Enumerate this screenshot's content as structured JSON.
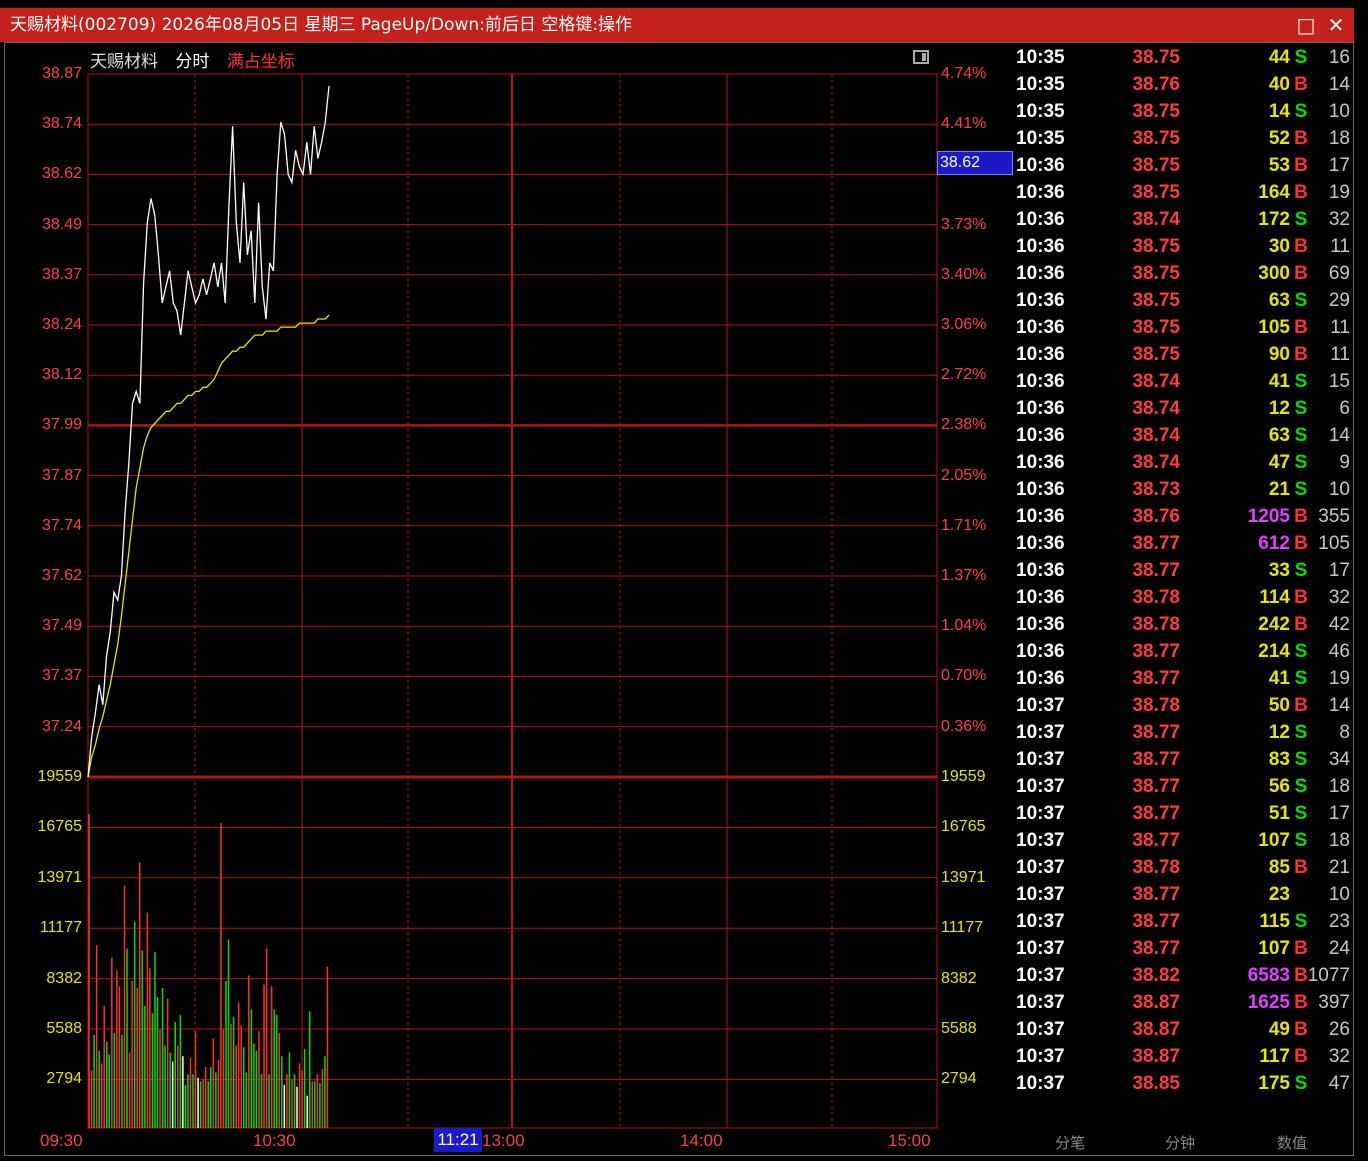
{
  "window": {
    "title": "天赐材料(002709) 2026年08月05日 星期三 PageUp/Down:前后日 空格键:操作",
    "maximize_icon": "□",
    "close_icon": "✕"
  },
  "header": {
    "stock_name": "天赐材料",
    "mode": "分时",
    "scale_mode": "满占坐标"
  },
  "colors": {
    "grid": "#b01414",
    "price_line": "#ffffff",
    "avg_line": "#e6e600",
    "vol_up": "#ff3030",
    "vol_down": "#00e000",
    "vol_flat": "#ffffff",
    "buy": "#ff3030",
    "sell": "#00e000",
    "vol_normal": "#e6e600",
    "vol_large": "#e040ff"
  },
  "price_axis": {
    "left": [
      "38.87",
      "38.74",
      "38.62",
      "38.49",
      "38.37",
      "38.24",
      "38.12",
      "37.99",
      "37.87",
      "37.74",
      "37.62",
      "37.49",
      "37.37",
      "37.24"
    ],
    "right": [
      "4.74%",
      "4.41%",
      "",
      "3.73%",
      "3.40%",
      "3.06%",
      "2.72%",
      "2.38%",
      "2.05%",
      "1.71%",
      "1.37%",
      "1.04%",
      "0.70%",
      "0.36%"
    ]
  },
  "volume_axis": {
    "left": [
      "19559",
      "16765",
      "13971",
      "11177",
      "8382",
      "5588",
      "2794"
    ],
    "right": [
      "19559",
      "16765",
      "13971",
      "11177",
      "8382",
      "5588",
      "2794"
    ]
  },
  "time_axis": [
    "09:30",
    "10:30",
    "13:00",
    "14:00",
    "15:00"
  ],
  "cursor": {
    "price_label": "38.62",
    "time_label": "11:21"
  },
  "chart_data": {
    "type": "line",
    "title": "",
    "xlabel": "",
    "ylabel": "",
    "ylim": [
      37.12,
      38.87
    ],
    "volume_ylim": [
      0,
      19559
    ],
    "x_range": [
      "09:30",
      "15:00"
    ],
    "series": [
      {
        "values": [
          37.12,
          37.22,
          37.28,
          37.35,
          37.3,
          37.42,
          37.48,
          37.58,
          37.56,
          37.62,
          37.78,
          37.9,
          38.05,
          38.08,
          38.05,
          38.35,
          38.5,
          38.56,
          38.52,
          38.42,
          38.3,
          38.34,
          38.38,
          38.3,
          38.28,
          38.22,
          38.3,
          38.38,
          38.34,
          38.3,
          38.32,
          38.36,
          38.32,
          38.36,
          38.4,
          38.34,
          38.4,
          38.3,
          38.54,
          38.74,
          38.5,
          38.4,
          38.6,
          38.42,
          38.48,
          38.3,
          38.55,
          38.34,
          38.26,
          38.4,
          38.38,
          38.62,
          38.75,
          38.72,
          38.62,
          38.6,
          38.68,
          38.64,
          38.62,
          38.7,
          38.62,
          38.74,
          38.66,
          38.7,
          38.75,
          38.84
        ]
      },
      {
        "values": [
          37.12,
          37.17,
          37.2,
          37.24,
          37.27,
          37.31,
          37.35,
          37.4,
          37.45,
          37.52,
          37.6,
          37.68,
          37.76,
          37.84,
          37.89,
          37.94,
          37.97,
          37.99,
          38.0,
          38.01,
          38.02,
          38.03,
          38.03,
          38.04,
          38.05,
          38.05,
          38.06,
          38.07,
          38.07,
          38.08,
          38.08,
          38.09,
          38.09,
          38.1,
          38.11,
          38.13,
          38.15,
          38.16,
          38.17,
          38.18,
          38.18,
          38.19,
          38.19,
          38.2,
          38.21,
          38.22,
          38.22,
          38.22,
          38.23,
          38.23,
          38.23,
          38.23,
          38.24,
          38.24,
          38.24,
          38.24,
          38.24,
          38.25,
          38.25,
          38.25,
          38.25,
          38.25,
          38.26,
          38.26,
          38.26,
          38.27
        ]
      }
    ],
    "volume": [
      17500,
      3200,
      5200,
      10200,
      4300,
      3600,
      6800,
      4800,
      4100,
      9500,
      5300,
      8800,
      7900,
      5200,
      13500,
      10000,
      4200,
      8200,
      11500,
      7800,
      14800,
      9900,
      6800,
      12000,
      8900,
      6400,
      9800,
      7300,
      5500,
      7800,
      4600,
      7200,
      4200,
      3700,
      5900,
      4600,
      6300,
      4000,
      2400,
      3000,
      3900,
      3000,
      5400,
      2800,
      2600,
      2700,
      3400,
      2600,
      3400,
      5000,
      3100,
      3800,
      17000,
      5500,
      8200,
      10500,
      5800,
      6200,
      4600,
      7000,
      5700,
      4500,
      3100,
      8500,
      6600,
      4700,
      4300,
      5400,
      3000,
      8000,
      10000,
      3000,
      7900,
      6600,
      6300,
      5300,
      4000,
      2400,
      3000,
      4200,
      2700,
      3000,
      2300,
      3600,
      3200,
      4400,
      1800,
      6500,
      2600,
      2600,
      3000,
      2500,
      3300,
      4000,
      9000
    ],
    "volume_dir": [
      "u",
      "u",
      "d",
      "u",
      "d",
      "u",
      "u",
      "d",
      "d",
      "u",
      "d",
      "u",
      "u",
      "d",
      "u",
      "d",
      "u",
      "u",
      "d",
      "u",
      "u",
      "d",
      "d",
      "u",
      "u",
      "d",
      "d",
      "d",
      "u",
      "d",
      "d",
      "u",
      "d",
      "f",
      "d",
      "u",
      "d",
      "f",
      "d",
      "d",
      "u",
      "d",
      "u",
      "f",
      "d",
      "u",
      "u",
      "d",
      "d",
      "u",
      "d",
      "u",
      "u",
      "u",
      "d",
      "d",
      "u",
      "d",
      "u",
      "u",
      "u",
      "d",
      "d",
      "u",
      "d",
      "d",
      "d",
      "u",
      "d",
      "u",
      "u",
      "d",
      "u",
      "d",
      "d",
      "u",
      "d",
      "f",
      "u",
      "d",
      "u",
      "d",
      "f",
      "u",
      "u",
      "d",
      "f",
      "d",
      "u",
      "d",
      "u",
      "d",
      "u",
      "d",
      "u"
    ]
  },
  "trades": [
    {
      "time": "10:35",
      "price": "38.75",
      "vol": "44",
      "side": "S",
      "num": "16"
    },
    {
      "time": "10:35",
      "price": "38.76",
      "vol": "40",
      "side": "B",
      "num": "14"
    },
    {
      "time": "10:35",
      "price": "38.75",
      "vol": "14",
      "side": "S",
      "num": "10"
    },
    {
      "time": "10:35",
      "price": "38.75",
      "vol": "52",
      "side": "B",
      "num": "18"
    },
    {
      "time": "10:36",
      "price": "38.75",
      "vol": "53",
      "side": "B",
      "num": "17"
    },
    {
      "time": "10:36",
      "price": "38.75",
      "vol": "164",
      "side": "B",
      "num": "19"
    },
    {
      "time": "10:36",
      "price": "38.74",
      "vol": "172",
      "side": "S",
      "num": "32"
    },
    {
      "time": "10:36",
      "price": "38.75",
      "vol": "30",
      "side": "B",
      "num": "11"
    },
    {
      "time": "10:36",
      "price": "38.75",
      "vol": "300",
      "side": "B",
      "num": "69"
    },
    {
      "time": "10:36",
      "price": "38.75",
      "vol": "63",
      "side": "S",
      "num": "29"
    },
    {
      "time": "10:36",
      "price": "38.75",
      "vol": "105",
      "side": "B",
      "num": "11"
    },
    {
      "time": "10:36",
      "price": "38.75",
      "vol": "90",
      "side": "B",
      "num": "11"
    },
    {
      "time": "10:36",
      "price": "38.74",
      "vol": "41",
      "side": "S",
      "num": "15"
    },
    {
      "time": "10:36",
      "price": "38.74",
      "vol": "12",
      "side": "S",
      "num": "6"
    },
    {
      "time": "10:36",
      "price": "38.74",
      "vol": "63",
      "side": "S",
      "num": "14"
    },
    {
      "time": "10:36",
      "price": "38.74",
      "vol": "47",
      "side": "S",
      "num": "9"
    },
    {
      "time": "10:36",
      "price": "38.73",
      "vol": "21",
      "side": "S",
      "num": "10"
    },
    {
      "time": "10:36",
      "price": "38.76",
      "vol": "1205",
      "side": "B",
      "num": "355"
    },
    {
      "time": "10:36",
      "price": "38.77",
      "vol": "612",
      "side": "B",
      "num": "105"
    },
    {
      "time": "10:36",
      "price": "38.77",
      "vol": "33",
      "side": "S",
      "num": "17"
    },
    {
      "time": "10:36",
      "price": "38.78",
      "vol": "114",
      "side": "B",
      "num": "32"
    },
    {
      "time": "10:36",
      "price": "38.78",
      "vol": "242",
      "side": "B",
      "num": "42"
    },
    {
      "time": "10:36",
      "price": "38.77",
      "vol": "214",
      "side": "S",
      "num": "46"
    },
    {
      "time": "10:36",
      "price": "38.77",
      "vol": "41",
      "side": "S",
      "num": "19"
    },
    {
      "time": "10:37",
      "price": "38.78",
      "vol": "50",
      "side": "B",
      "num": "14"
    },
    {
      "time": "10:37",
      "price": "38.77",
      "vol": "12",
      "side": "S",
      "num": "8"
    },
    {
      "time": "10:37",
      "price": "38.77",
      "vol": "83",
      "side": "S",
      "num": "34"
    },
    {
      "time": "10:37",
      "price": "38.77",
      "vol": "56",
      "side": "S",
      "num": "18"
    },
    {
      "time": "10:37",
      "price": "38.77",
      "vol": "51",
      "side": "S",
      "num": "17"
    },
    {
      "time": "10:37",
      "price": "38.77",
      "vol": "107",
      "side": "S",
      "num": "18"
    },
    {
      "time": "10:37",
      "price": "38.78",
      "vol": "85",
      "side": "B",
      "num": "21"
    },
    {
      "time": "10:37",
      "price": "38.77",
      "vol": "23",
      "side": "",
      "num": "10"
    },
    {
      "time": "10:37",
      "price": "38.77",
      "vol": "115",
      "side": "S",
      "num": "23"
    },
    {
      "time": "10:37",
      "price": "38.77",
      "vol": "107",
      "side": "B",
      "num": "24"
    },
    {
      "time": "10:37",
      "price": "38.82",
      "vol": "6583",
      "side": "B",
      "num": "1077"
    },
    {
      "time": "10:37",
      "price": "38.87",
      "vol": "1625",
      "side": "B",
      "num": "397"
    },
    {
      "time": "10:37",
      "price": "38.87",
      "vol": "49",
      "side": "B",
      "num": "26"
    },
    {
      "time": "10:37",
      "price": "38.87",
      "vol": "117",
      "side": "B",
      "num": "32"
    },
    {
      "time": "10:37",
      "price": "38.85",
      "vol": "175",
      "side": "S",
      "num": "47"
    }
  ],
  "bottom_tabs": [
    "分笔",
    "分钟",
    "数值"
  ]
}
